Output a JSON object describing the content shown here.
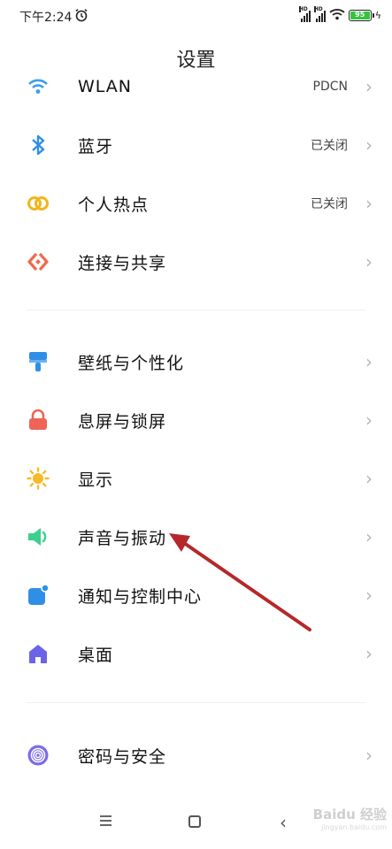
{
  "status_bar": {
    "time": "下午2:24",
    "battery_level": "95",
    "signal_badge": "HD"
  },
  "header": {
    "title": "设置"
  },
  "items": [
    {
      "label": "WLAN",
      "value": "PDCN",
      "icon": "wifi-icon",
      "color": "#3aa0e8"
    },
    {
      "label": "蓝牙",
      "value": "已关闭",
      "icon": "bluetooth-icon",
      "color": "#2f8fe6"
    },
    {
      "label": "个人热点",
      "value": "已关闭",
      "icon": "hotspot-icon",
      "color": "#f2b51c"
    },
    {
      "label": "连接与共享",
      "value": "",
      "icon": "connection-sharing-icon",
      "color": "#ef6a4f"
    },
    {
      "label": "壁纸与个性化",
      "value": "",
      "icon": "wallpaper-brush-icon",
      "color": "#2f8fe6"
    },
    {
      "label": "息屏与锁屏",
      "value": "",
      "icon": "lock-icon",
      "color": "#ee6456"
    },
    {
      "label": "显示",
      "value": "",
      "icon": "sun-icon",
      "color": "#f7b928"
    },
    {
      "label": "声音与振动",
      "value": "",
      "icon": "speaker-icon",
      "color": "#3ccf8e"
    },
    {
      "label": "通知与控制中心",
      "value": "",
      "icon": "notification-icon",
      "color": "#2f8fe6"
    },
    {
      "label": "桌面",
      "value": "",
      "icon": "home-icon",
      "color": "#6b63e8"
    },
    {
      "label": "密码与安全",
      "value": "",
      "icon": "fingerprint-icon",
      "color": "#7c6ce8"
    }
  ],
  "chevron": "›",
  "annotation": {
    "arrow_color": "#b5282a"
  },
  "watermark": {
    "text": "Baidu 经验",
    "sub": "jingyan.baidu.com"
  }
}
